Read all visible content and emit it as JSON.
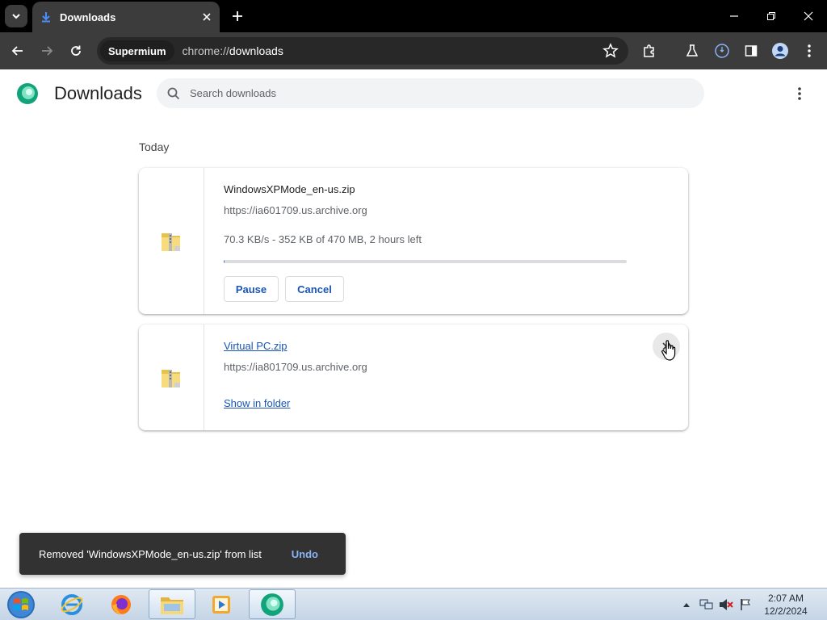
{
  "browser": {
    "tab_title": "Downloads",
    "site_chip": "Supermium",
    "url_scheme": "chrome://",
    "url_path": "downloads"
  },
  "page": {
    "title": "Downloads",
    "search_placeholder": "Search downloads",
    "section_label": "Today"
  },
  "downloads": [
    {
      "filename": "WindowsXPMode_en-us.zip",
      "url": "https://ia601709.us.archive.org",
      "status": "70.3 KB/s - 352 KB of 470 MB, 2 hours left",
      "progress": 0.0007,
      "pause_label": "Pause",
      "cancel_label": "Cancel"
    },
    {
      "filename": "Virtual PC.zip",
      "url": "https://ia801709.us.archive.org",
      "show_folder_label": "Show in folder"
    }
  ],
  "toast": {
    "message": "Removed 'WindowsXPMode_en-us.zip' from list",
    "undo_label": "Undo"
  },
  "taskbar": {
    "time": "2:07 AM",
    "date": "12/2/2024"
  },
  "colors": {
    "accent_link": "#1a55b5",
    "toolbar": "#3c3c3c",
    "titlebar": "#000000",
    "toast_bg": "#323232",
    "toast_action": "#8ab4f8"
  }
}
